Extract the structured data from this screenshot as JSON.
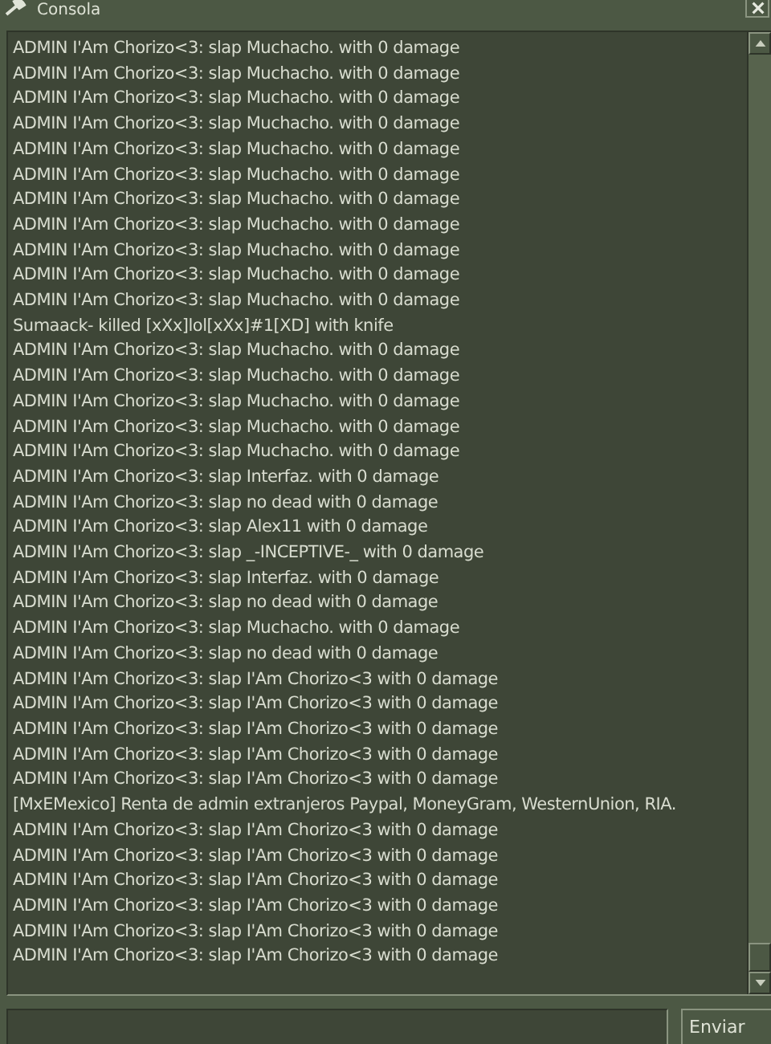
{
  "window": {
    "title": "Consola"
  },
  "console_lines": [
    "ADMIN I'Am Chorizo<3: slap Muchacho. with 0 damage",
    "ADMIN I'Am Chorizo<3: slap Muchacho. with 0 damage",
    "ADMIN I'Am Chorizo<3: slap Muchacho. with 0 damage",
    "ADMIN I'Am Chorizo<3: slap Muchacho. with 0 damage",
    "ADMIN I'Am Chorizo<3: slap Muchacho. with 0 damage",
    "ADMIN I'Am Chorizo<3: slap Muchacho. with 0 damage",
    "ADMIN I'Am Chorizo<3: slap Muchacho. with 0 damage",
    "ADMIN I'Am Chorizo<3: slap Muchacho. with 0 damage",
    "ADMIN I'Am Chorizo<3: slap Muchacho. with 0 damage",
    "ADMIN I'Am Chorizo<3: slap Muchacho. with 0 damage",
    "ADMIN I'Am Chorizo<3: slap Muchacho. with 0 damage",
    "Sumaack- killed [xXx]lol[xXx]#1[XD] with knife",
    "ADMIN I'Am Chorizo<3: slap Muchacho. with 0 damage",
    "ADMIN I'Am Chorizo<3: slap Muchacho. with 0 damage",
    "ADMIN I'Am Chorizo<3: slap Muchacho. with 0 damage",
    "ADMIN I'Am Chorizo<3: slap Muchacho. with 0 damage",
    "ADMIN I'Am Chorizo<3: slap Muchacho. with 0 damage",
    "ADMIN I'Am Chorizo<3: slap Interfaz. with 0 damage",
    "ADMIN I'Am Chorizo<3: slap no dead with 0 damage",
    "ADMIN I'Am Chorizo<3: slap Alex11 with 0 damage",
    "ADMIN I'Am Chorizo<3: slap _-INCEPTIVE-_ with 0 damage",
    "ADMIN I'Am Chorizo<3: slap Interfaz. with 0 damage",
    "ADMIN I'Am Chorizo<3: slap no dead with 0 damage",
    "ADMIN I'Am Chorizo<3: slap Muchacho. with 0 damage",
    "ADMIN I'Am Chorizo<3: slap no dead with 0 damage",
    "ADMIN I'Am Chorizo<3: slap I'Am Chorizo<3 with 0 damage",
    "ADMIN I'Am Chorizo<3: slap I'Am Chorizo<3 with 0 damage",
    "ADMIN I'Am Chorizo<3: slap I'Am Chorizo<3 with 0 damage",
    "ADMIN I'Am Chorizo<3: slap I'Am Chorizo<3 with 0 damage",
    "ADMIN I'Am Chorizo<3: slap I'Am Chorizo<3 with 0 damage",
    "[MxEMexico] Renta de admin extranjeros Paypal, MoneyGram, WesternUnion, RIA.",
    "ADMIN I'Am Chorizo<3: slap I'Am Chorizo<3 with 0 damage",
    "ADMIN I'Am Chorizo<3: slap I'Am Chorizo<3 with 0 damage",
    "ADMIN I'Am Chorizo<3: slap I'Am Chorizo<3 with 0 damage",
    "ADMIN I'Am Chorizo<3: slap I'Am Chorizo<3 with 0 damage",
    "ADMIN I'Am Chorizo<3: slap I'Am Chorizo<3 with 0 damage",
    "ADMIN I'Am Chorizo<3: slap I'Am Chorizo<3 with 0 damage"
  ],
  "send_button": {
    "label": "Enviar"
  }
}
